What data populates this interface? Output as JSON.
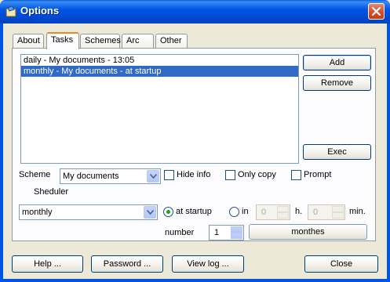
{
  "window": {
    "title": "Options"
  },
  "tabs": [
    "About",
    "Tasks",
    "Schemes",
    "Arc",
    "Other"
  ],
  "tasks": {
    "items": [
      {
        "label": "daily - My documents - 13:05",
        "selected": false
      },
      {
        "label": "monthly - My documents - at startup",
        "selected": true
      }
    ],
    "add_label": "Add",
    "remove_label": "Remove",
    "exec_label": "Exec"
  },
  "scheme": {
    "label": "Scheme",
    "value": "My documents",
    "hide_info": "Hide info",
    "only_copy": "Only copy",
    "prompt": "Prompt"
  },
  "scheduler": {
    "group_label": "Sheduler",
    "period_value": "monthly",
    "at_startup_label": "at startup",
    "at_startup_selected": true,
    "in_label": "in",
    "hours_value": "0",
    "hours_unit": "h.",
    "minutes_value": "0",
    "minutes_unit": "min.",
    "number_label": "number",
    "number_value": "1",
    "unit_button_label": "monthes"
  },
  "bottom_buttons": {
    "help": "Help ...",
    "password": "Password ...",
    "view_log": "View log ...",
    "close": "Close"
  },
  "colors": {
    "title_bar": "#0055E5",
    "selection": "#316AC5",
    "tab_accent": "#E68B2C"
  }
}
